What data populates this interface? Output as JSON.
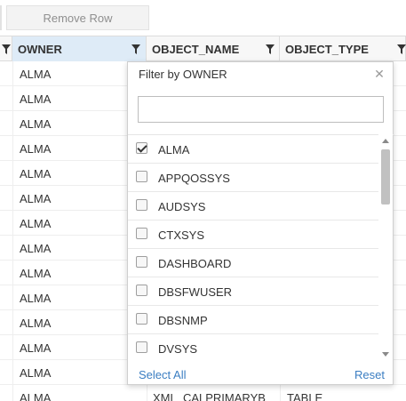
{
  "toolbar": {
    "remove_row_label": "Remove Row"
  },
  "columns": {
    "owner": "OWNER",
    "object_name": "OBJECT_NAME",
    "object_type": "OBJECT_TYPE"
  },
  "rows": [
    {
      "owner": "ALMA",
      "object_name": "",
      "object_type": ""
    },
    {
      "owner": "ALMA",
      "object_name": "",
      "object_type": ""
    },
    {
      "owner": "ALMA",
      "object_name": "",
      "object_type": ""
    },
    {
      "owner": "ALMA",
      "object_name": "",
      "object_type": ""
    },
    {
      "owner": "ALMA",
      "object_name": "",
      "object_type": ""
    },
    {
      "owner": "ALMA",
      "object_name": "",
      "object_type": ""
    },
    {
      "owner": "ALMA",
      "object_name": "",
      "object_type": ""
    },
    {
      "owner": "ALMA",
      "object_name": "",
      "object_type": ""
    },
    {
      "owner": "ALMA",
      "object_name": "",
      "object_type": ""
    },
    {
      "owner": "ALMA",
      "object_name": "",
      "object_type": ""
    },
    {
      "owner": "ALMA",
      "object_name": "",
      "object_type": ""
    },
    {
      "owner": "ALMA",
      "object_name": "",
      "object_type": ""
    },
    {
      "owner": "ALMA",
      "object_name": "",
      "object_type": ""
    },
    {
      "owner": "ALMA",
      "object_name": "XML_CALPRIMARYB",
      "object_type": "TABLE"
    }
  ],
  "filter_popup": {
    "title": "Filter by OWNER",
    "search_value": "",
    "options": [
      {
        "label": "ALMA",
        "checked": true
      },
      {
        "label": "APPQOSSYS",
        "checked": false
      },
      {
        "label": "AUDSYS",
        "checked": false
      },
      {
        "label": "CTXSYS",
        "checked": false
      },
      {
        "label": "DASHBOARD",
        "checked": false
      },
      {
        "label": "DBSFWUSER",
        "checked": false
      },
      {
        "label": "DBSNMP",
        "checked": false
      },
      {
        "label": "DVSYS",
        "checked": false
      }
    ],
    "select_all_label": "Select All",
    "reset_label": "Reset"
  },
  "icons": {
    "filter": "filter-funnel-icon",
    "close": "close-icon",
    "check": "checkmark-icon"
  },
  "colors": {
    "active_header": "#deebf7",
    "link": "#3b7ec2"
  }
}
